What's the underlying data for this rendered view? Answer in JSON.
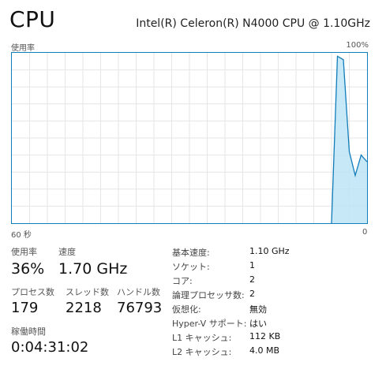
{
  "header": {
    "title": "CPU",
    "model": "Intel(R) Celeron(R) N4000 CPU @ 1.10GHz"
  },
  "graph": {
    "y_label": "使用率",
    "y_max_label": "100%",
    "x_left_label": "60 秒",
    "x_right_label": "0",
    "line_color": "#117dbb",
    "fill_color": "#bde4f5",
    "grid_color": "#e6e6e6",
    "series": [
      {
        "t": 60,
        "v": 0
      },
      {
        "t": 59,
        "v": 0
      },
      {
        "t": 58,
        "v": 0
      },
      {
        "t": 57,
        "v": 0
      },
      {
        "t": 56,
        "v": 0
      },
      {
        "t": 55,
        "v": 0
      },
      {
        "t": 54,
        "v": 0
      },
      {
        "t": 53,
        "v": 0
      },
      {
        "t": 52,
        "v": 0
      },
      {
        "t": 51,
        "v": 0
      },
      {
        "t": 50,
        "v": 0
      },
      {
        "t": 49,
        "v": 0
      },
      {
        "t": 48,
        "v": 0
      },
      {
        "t": 47,
        "v": 0
      },
      {
        "t": 46,
        "v": 0
      },
      {
        "t": 45,
        "v": 0
      },
      {
        "t": 44,
        "v": 0
      },
      {
        "t": 43,
        "v": 0
      },
      {
        "t": 42,
        "v": 0
      },
      {
        "t": 41,
        "v": 0
      },
      {
        "t": 40,
        "v": 0
      },
      {
        "t": 39,
        "v": 0
      },
      {
        "t": 38,
        "v": 0
      },
      {
        "t": 37,
        "v": 0
      },
      {
        "t": 36,
        "v": 0
      },
      {
        "t": 35,
        "v": 0
      },
      {
        "t": 34,
        "v": 0
      },
      {
        "t": 33,
        "v": 0
      },
      {
        "t": 32,
        "v": 0
      },
      {
        "t": 31,
        "v": 0
      },
      {
        "t": 30,
        "v": 0
      },
      {
        "t": 29,
        "v": 0
      },
      {
        "t": 28,
        "v": 0
      },
      {
        "t": 27,
        "v": 0
      },
      {
        "t": 26,
        "v": 0
      },
      {
        "t": 25,
        "v": 0
      },
      {
        "t": 24,
        "v": 0
      },
      {
        "t": 23,
        "v": 0
      },
      {
        "t": 22,
        "v": 0
      },
      {
        "t": 21,
        "v": 0
      },
      {
        "t": 20,
        "v": 0
      },
      {
        "t": 19,
        "v": 0
      },
      {
        "t": 18,
        "v": 0
      },
      {
        "t": 17,
        "v": 0
      },
      {
        "t": 16,
        "v": 0
      },
      {
        "t": 15,
        "v": 0
      },
      {
        "t": 14,
        "v": 0
      },
      {
        "t": 13,
        "v": 0
      },
      {
        "t": 12,
        "v": 0
      },
      {
        "t": 11,
        "v": 0
      },
      {
        "t": 10,
        "v": 0
      },
      {
        "t": 9,
        "v": 0
      },
      {
        "t": 8,
        "v": 0
      },
      {
        "t": 7,
        "v": 0
      },
      {
        "t": 6,
        "v": 0
      },
      {
        "t": 5,
        "v": 98
      },
      {
        "t": 4,
        "v": 96
      },
      {
        "t": 3,
        "v": 42
      },
      {
        "t": 2,
        "v": 28
      },
      {
        "t": 1,
        "v": 40
      },
      {
        "t": 0,
        "v": 36
      }
    ]
  },
  "stats": {
    "usage_label": "使用率",
    "usage_value": "36%",
    "speed_label": "速度",
    "speed_value": "1.70 GHz",
    "processes_label": "プロセス数",
    "processes_value": "179",
    "threads_label": "スレッド数",
    "threads_value": "2218",
    "handles_label": "ハンドル数",
    "handles_value": "76793",
    "uptime_label": "稼働時間",
    "uptime_value": "0:04:31:02"
  },
  "info": [
    {
      "key": "基本速度:",
      "value": "1.10 GHz"
    },
    {
      "key": "ソケット:",
      "value": "1"
    },
    {
      "key": "コア:",
      "value": "2"
    },
    {
      "key": "論理プロセッサ数:",
      "value": "2"
    },
    {
      "key": "仮想化:",
      "value": "無効"
    },
    {
      "key": "Hyper-V サポート:",
      "value": "はい"
    },
    {
      "key": "L1 キャッシュ:",
      "value": "112 KB"
    },
    {
      "key": "L2 キャッシュ:",
      "value": "4.0 MB"
    }
  ]
}
